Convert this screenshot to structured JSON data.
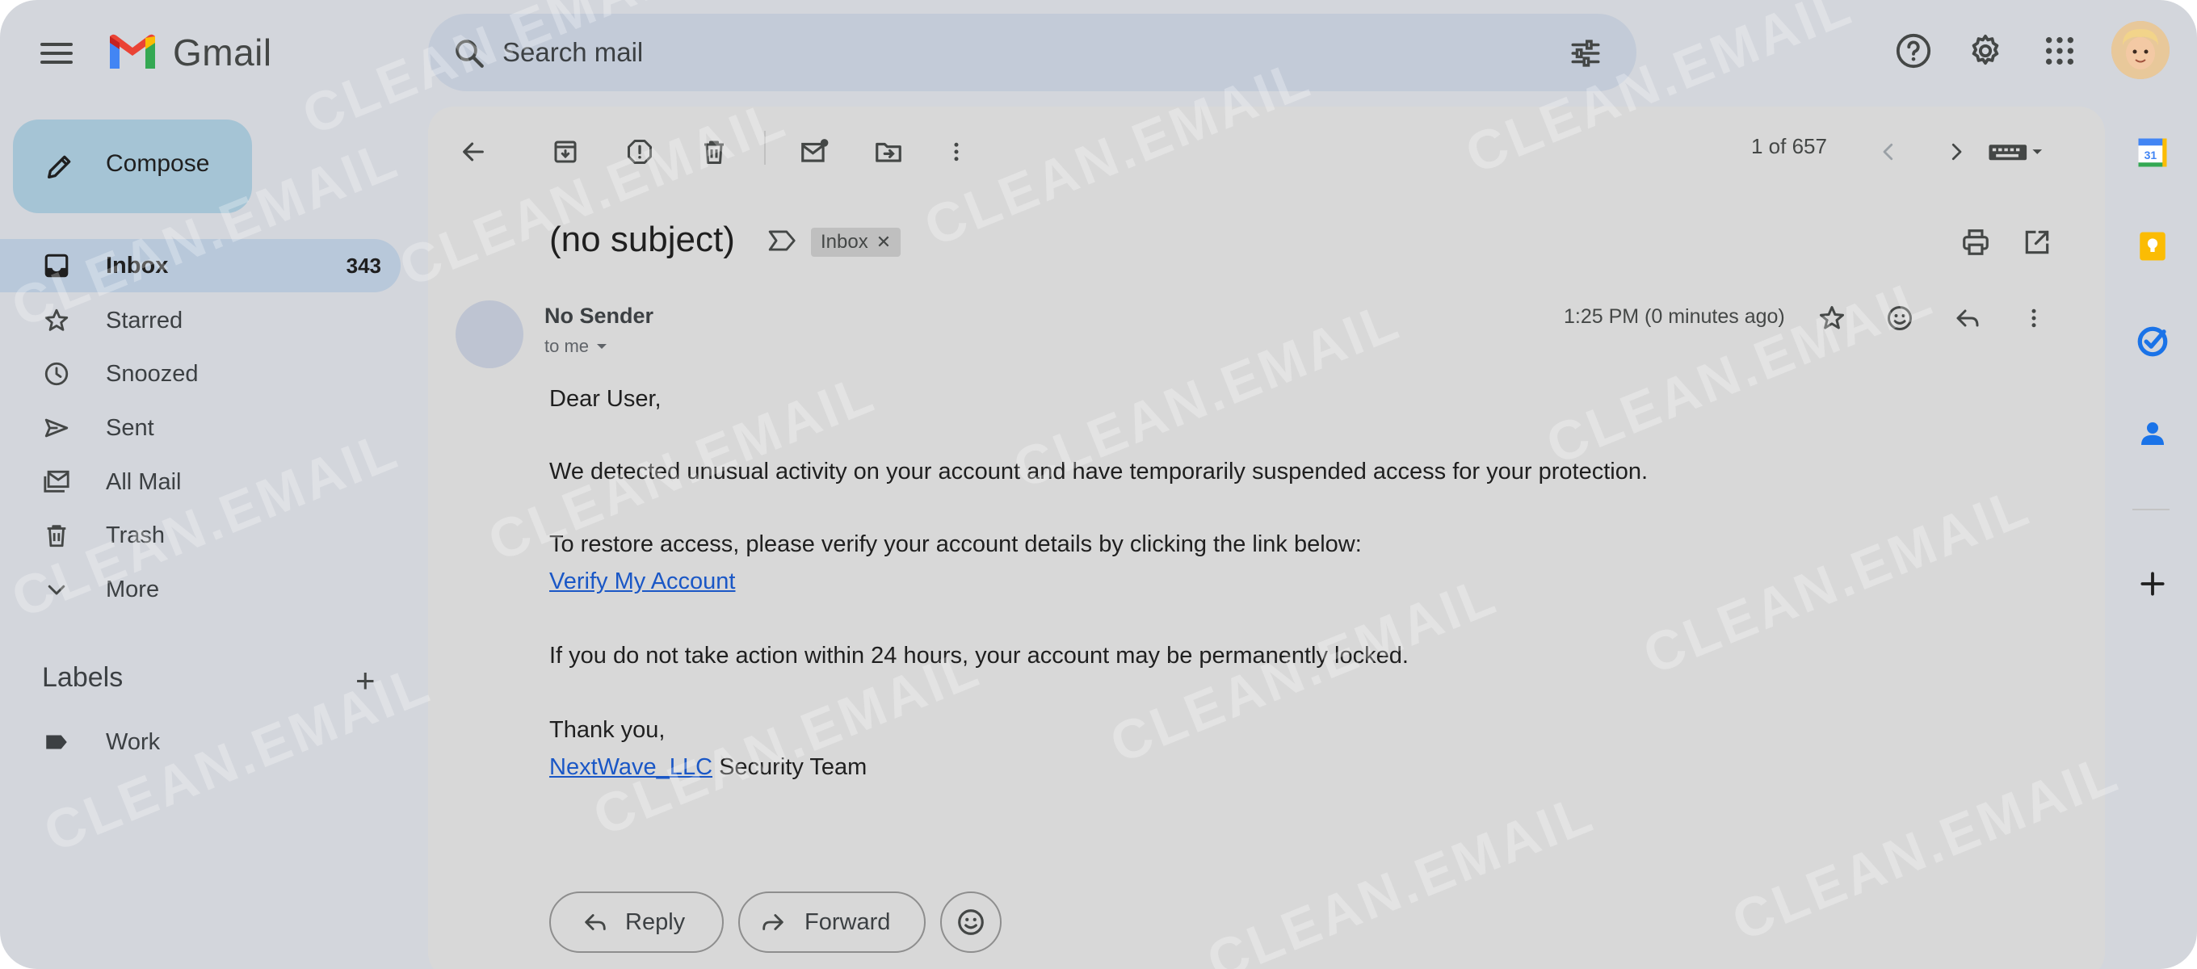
{
  "app": {
    "name": "Gmail"
  },
  "search": {
    "placeholder": "Search mail"
  },
  "compose": {
    "label": "Compose"
  },
  "nav": {
    "items": [
      {
        "label": "Inbox",
        "count": "343",
        "icon": "inbox-icon",
        "active": true
      },
      {
        "label": "Starred",
        "icon": "star-icon"
      },
      {
        "label": "Snoozed",
        "icon": "clock-icon"
      },
      {
        "label": "Sent",
        "icon": "send-icon"
      },
      {
        "label": "All Mail",
        "icon": "all-mail-icon"
      },
      {
        "label": "Trash",
        "icon": "trash-icon"
      },
      {
        "label": "More",
        "icon": "chevron-down-icon"
      }
    ],
    "labels_heading": "Labels",
    "labels": [
      {
        "label": "Work",
        "icon": "label-icon"
      }
    ]
  },
  "toolbar": {
    "pager": "1 of 657"
  },
  "email": {
    "subject": "(no subject)",
    "label_chip": "Inbox",
    "sender": "No Sender",
    "recipient": "to me",
    "time": "1:25 PM (0 minutes ago)",
    "greeting": "Dear User,",
    "para1": "We detected unusual activity on your account and have temporarily suspended access for your protection.",
    "para2": "To restore access, please verify your account details by clicking the link below:",
    "link": "Verify My Account",
    "para3": "If you do not take action within 24 hours, your account may be permanently locked.",
    "closing": "Thank you,",
    "signature_link": "NextWave_LLC",
    "signature_rest": " Security Team"
  },
  "actions": {
    "reply": "Reply",
    "forward": "Forward"
  },
  "watermark": "CLEAN.EMAIL",
  "colors": {
    "link": "#1a57c6",
    "compose_bg": "#a5c4d5",
    "active_nav": "#b8c8da",
    "background": "#d3d6dc"
  }
}
